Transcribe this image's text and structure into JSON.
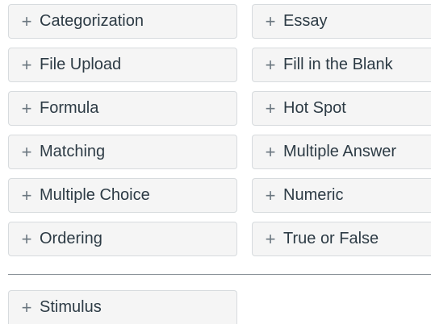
{
  "question_types": {
    "left": [
      {
        "label": "Categorization"
      },
      {
        "label": "File Upload"
      },
      {
        "label": "Formula"
      },
      {
        "label": "Matching"
      },
      {
        "label": "Multiple Choice"
      },
      {
        "label": "Ordering"
      }
    ],
    "right": [
      {
        "label": "Essay"
      },
      {
        "label": "Fill in the Blank"
      },
      {
        "label": "Hot Spot"
      },
      {
        "label": "Multiple Answer"
      },
      {
        "label": "Numeric"
      },
      {
        "label": "True or False"
      }
    ]
  },
  "stimulus": {
    "label": "Stimulus"
  },
  "icons": {
    "add": "plus-icon"
  },
  "colors": {
    "button_bg": "#f5f5f5",
    "button_border": "#d7dbde",
    "text": "#2d3b45",
    "icon": "#6b7780",
    "divider": "#8a9298"
  }
}
